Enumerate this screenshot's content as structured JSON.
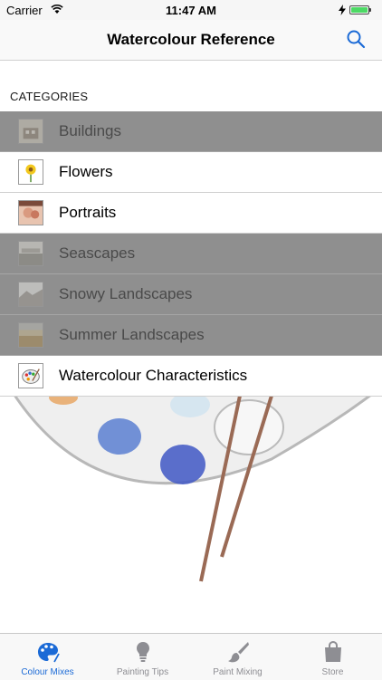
{
  "status_bar": {
    "carrier": "Carrier",
    "time": "11:47 AM"
  },
  "nav": {
    "title": "Watercolour Reference",
    "search_icon": "search-icon"
  },
  "section_header": "CATEGORIES",
  "categories": [
    {
      "label": "Buildings",
      "icon": "buildings-thumbnail"
    },
    {
      "label": "Flowers",
      "icon": "flowers-thumbnail"
    },
    {
      "label": "Portraits",
      "icon": "portraits-thumbnail"
    },
    {
      "label": "Seascapes",
      "icon": "seascapes-thumbnail"
    },
    {
      "label": "Snowy Landscapes",
      "icon": "snowy-landscapes-thumbnail"
    },
    {
      "label": "Summer Landscapes",
      "icon": "summer-landscapes-thumbnail"
    },
    {
      "label": "Watercolour Characteristics",
      "icon": "palette-thumbnail"
    }
  ],
  "tabs": [
    {
      "label": "Colour Mixes",
      "icon": "palette-icon",
      "active": true
    },
    {
      "label": "Painting Tips",
      "icon": "lightbulb-icon",
      "active": false
    },
    {
      "label": "Paint Mixing",
      "icon": "paintbrush-icon",
      "active": false
    },
    {
      "label": "Store",
      "icon": "shopping-bag-icon",
      "active": false
    }
  ],
  "colors": {
    "accent": "#1b6ad6",
    "dim_row": "#8f8f8f"
  }
}
